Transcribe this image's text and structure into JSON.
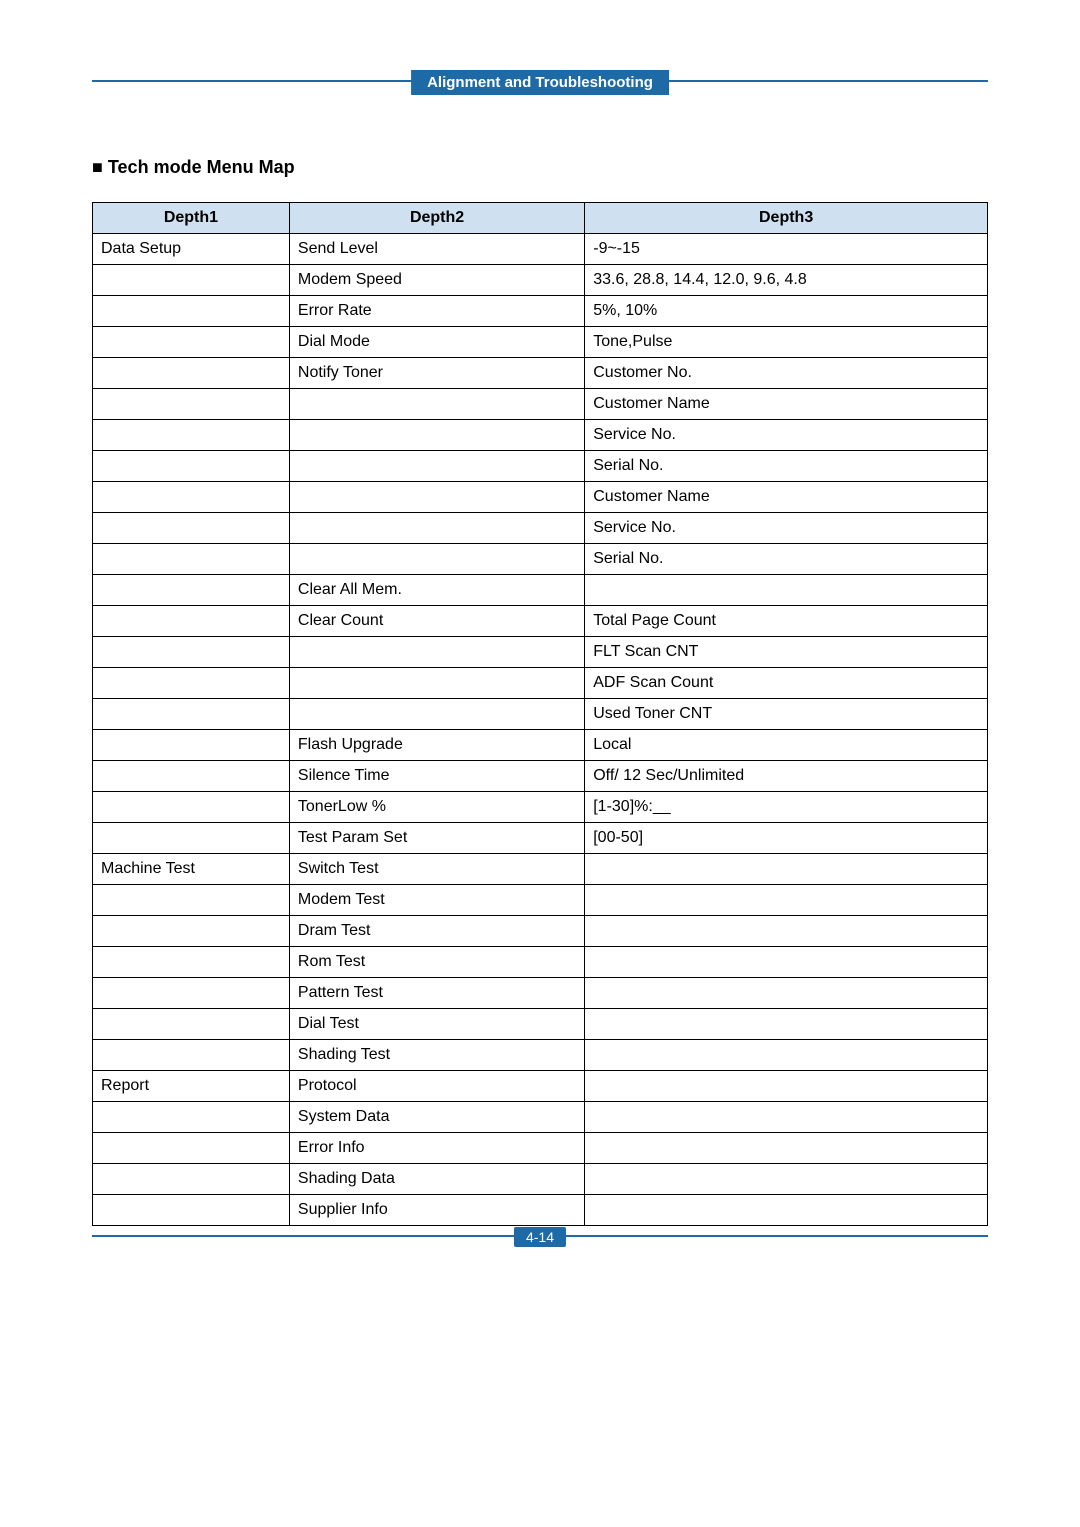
{
  "header": {
    "section": "Alignment and Troubleshooting"
  },
  "title": {
    "bullet": "■",
    "text": "Tech mode Menu Map"
  },
  "columns": {
    "c1": "Depth1",
    "c2": "Depth2",
    "c3": "Depth3"
  },
  "rows": [
    {
      "d1": "Data Setup",
      "d2": "Send Level",
      "d3": "-9~-15",
      "d1edge": "top",
      "d2edge": "both"
    },
    {
      "d1": "",
      "d2": "Modem Speed",
      "d3": "33.6, 28.8, 14.4, 12.0, 9.6, 4.8",
      "d1edge": "mid",
      "d2edge": "both"
    },
    {
      "d1": "",
      "d2": "Error Rate",
      "d3": "5%, 10%",
      "d1edge": "mid",
      "d2edge": "both"
    },
    {
      "d1": "",
      "d2": "Dial Mode",
      "d3": "Tone,Pulse",
      "d1edge": "mid",
      "d2edge": "both"
    },
    {
      "d1": "",
      "d2": "Notify Toner",
      "d3": "Customer No.",
      "d1edge": "mid",
      "d2edge": "top"
    },
    {
      "d1": "",
      "d2": "",
      "d3": "Customer Name",
      "d1edge": "mid",
      "d2edge": "mid"
    },
    {
      "d1": "",
      "d2": "",
      "d3": "Service No.",
      "d1edge": "mid",
      "d2edge": "mid"
    },
    {
      "d1": "",
      "d2": "",
      "d3": "Serial No.",
      "d1edge": "mid",
      "d2edge": "mid"
    },
    {
      "d1": "",
      "d2": "",
      "d3": "Customer Name",
      "d1edge": "mid",
      "d2edge": "mid"
    },
    {
      "d1": "",
      "d2": "",
      "d3": "Service No.",
      "d1edge": "mid",
      "d2edge": "mid"
    },
    {
      "d1": "",
      "d2": "",
      "d3": "Serial No.",
      "d1edge": "mid",
      "d2edge": "bot"
    },
    {
      "d1": "",
      "d2": "Clear All Mem.",
      "d3": "",
      "d1edge": "mid",
      "d2edge": "both"
    },
    {
      "d1": "",
      "d2": "Clear Count",
      "d3": "Total Page Count",
      "d1edge": "mid",
      "d2edge": "top"
    },
    {
      "d1": "",
      "d2": "",
      "d3": "FLT Scan CNT",
      "d1edge": "mid",
      "d2edge": "mid"
    },
    {
      "d1": "",
      "d2": "",
      "d3": "ADF Scan Count",
      "d1edge": "mid",
      "d2edge": "mid"
    },
    {
      "d1": "",
      "d2": "",
      "d3": "Used Toner CNT",
      "d1edge": "mid",
      "d2edge": "bot"
    },
    {
      "d1": "",
      "d2": "Flash Upgrade",
      "d3": "Local",
      "d1edge": "mid",
      "d2edge": "both"
    },
    {
      "d1": "",
      "d2": "Silence Time",
      "d3": "Off/ 12 Sec/Unlimited",
      "d1edge": "mid",
      "d2edge": "both"
    },
    {
      "d1": "",
      "d2": "TonerLow %",
      "d3": "[1-30]%:__",
      "d1edge": "mid",
      "d2edge": "both"
    },
    {
      "d1": "",
      "d2": "Test Param Set",
      "d3": "[00-50]",
      "d1edge": "bot",
      "d2edge": "both"
    },
    {
      "d1": "Machine Test",
      "d2": "Switch Test",
      "d3": "",
      "d1edge": "top",
      "d2edge": "both"
    },
    {
      "d1": "",
      "d2": "Modem Test",
      "d3": "",
      "d1edge": "mid",
      "d2edge": "both"
    },
    {
      "d1": "",
      "d2": "Dram Test",
      "d3": "",
      "d1edge": "mid",
      "d2edge": "both"
    },
    {
      "d1": "",
      "d2": "Rom Test",
      "d3": "",
      "d1edge": "mid",
      "d2edge": "both"
    },
    {
      "d1": "",
      "d2": "Pattern Test",
      "d3": "",
      "d1edge": "mid",
      "d2edge": "both"
    },
    {
      "d1": "",
      "d2": "Dial Test",
      "d3": "",
      "d1edge": "mid",
      "d2edge": "both"
    },
    {
      "d1": "",
      "d2": "Shading Test",
      "d3": "",
      "d1edge": "bot",
      "d2edge": "both"
    },
    {
      "d1": "Report",
      "d2": "Protocol",
      "d3": "",
      "d1edge": "top",
      "d2edge": "both"
    },
    {
      "d1": "",
      "d2": "System Data",
      "d3": "",
      "d1edge": "mid",
      "d2edge": "both"
    },
    {
      "d1": "",
      "d2": "Error Info",
      "d3": "",
      "d1edge": "mid",
      "d2edge": "both"
    },
    {
      "d1": "",
      "d2": "Shading Data",
      "d3": "",
      "d1edge": "mid",
      "d2edge": "both"
    },
    {
      "d1": "",
      "d2": "Supplier Info",
      "d3": "",
      "d1edge": "bot",
      "d2edge": "both"
    }
  ],
  "footer": {
    "page": "4-14"
  }
}
